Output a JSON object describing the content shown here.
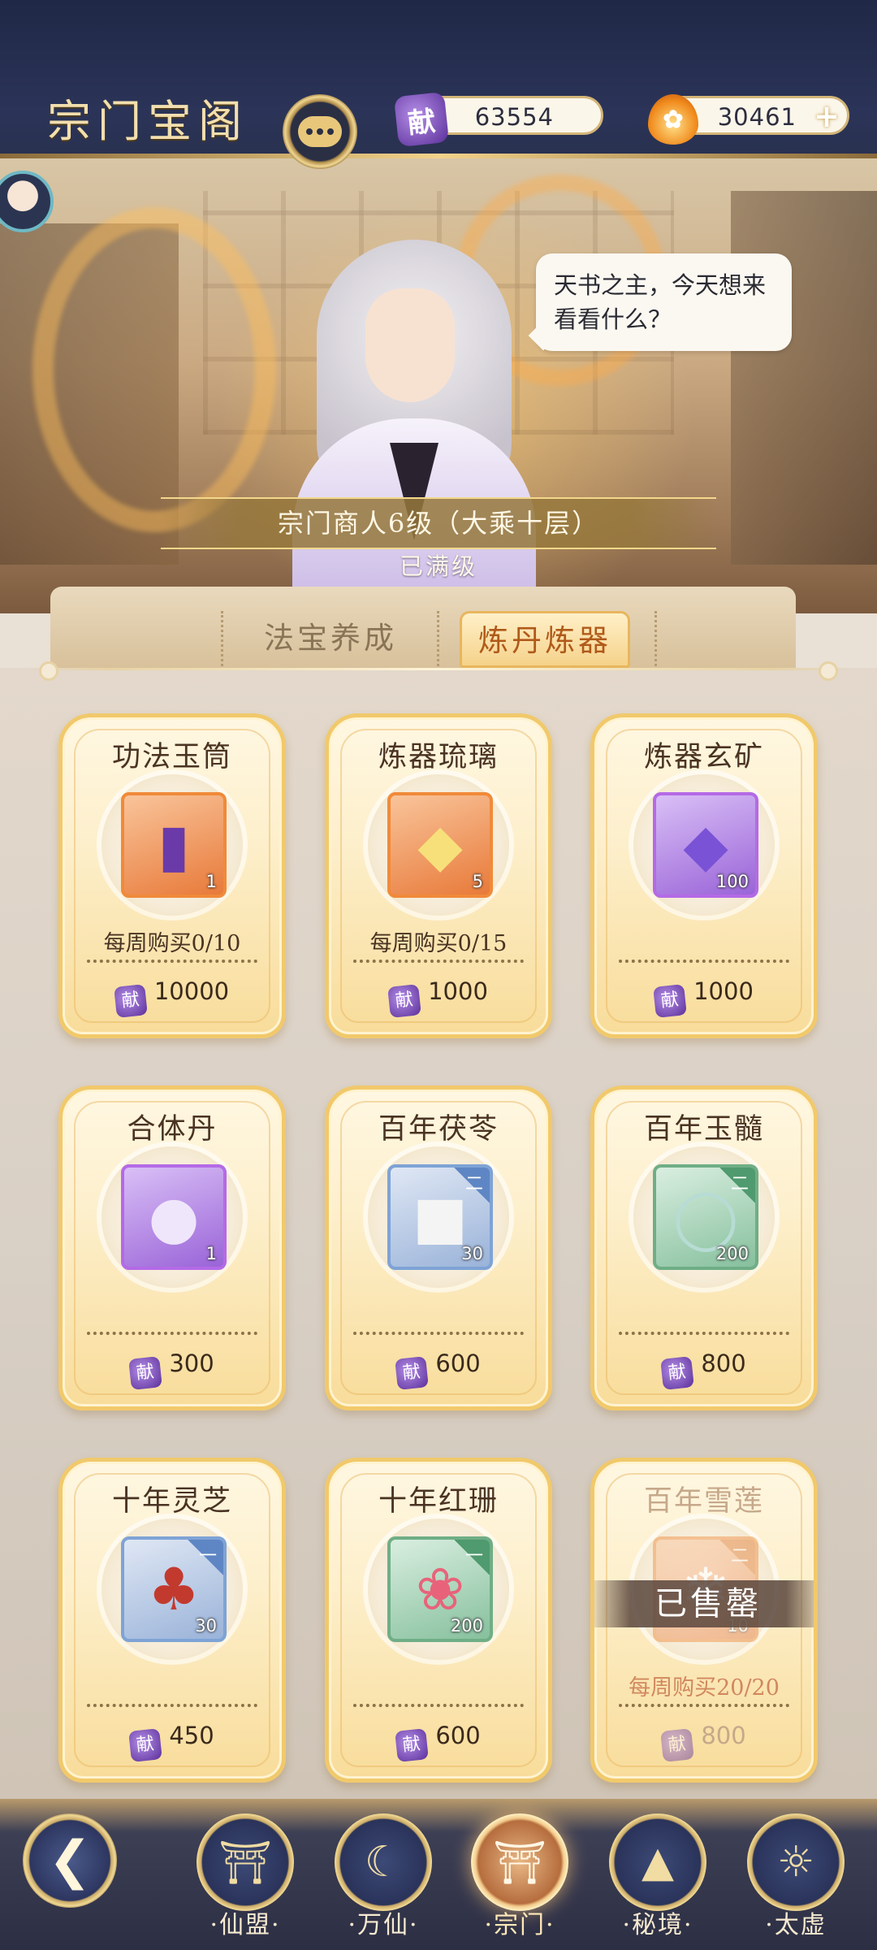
{
  "header": {
    "title": "宗门宝阁",
    "chat_icon": "chat-bubble-icon",
    "currency_contribution": {
      "icon": "contribution-token-icon",
      "icon_text": "献",
      "value": "63554"
    },
    "currency_spirit": {
      "icon": "flame-spirit-icon",
      "value": "30461",
      "plus": "+"
    }
  },
  "hero": {
    "speech": "天书之主，今天想来看看什么？",
    "merchant_level": "宗门商人6级（大乘十层）",
    "max_level": "已满级"
  },
  "tabs": [
    {
      "label": "法宝养成",
      "active": false
    },
    {
      "label": "炼丹炼器",
      "active": true
    }
  ],
  "shop": {
    "currency_icon_text": "献",
    "sold_out_label": "已售罄",
    "items": [
      {
        "name": "功法玉筒",
        "rarity": "orange",
        "tier": "",
        "qty": "1",
        "limit": "每周购买0/10",
        "price": "10000",
        "icon": "jade-scroll-icon"
      },
      {
        "name": "炼器琉璃",
        "rarity": "orange",
        "tier": "",
        "qty": "5",
        "limit": "每周购买0/15",
        "price": "1000",
        "icon": "crystal-cluster-icon"
      },
      {
        "name": "炼器玄矿",
        "rarity": "purple",
        "tier": "",
        "qty": "100",
        "limit": "",
        "price": "1000",
        "icon": "purple-ore-icon"
      },
      {
        "name": "合体丹",
        "rarity": "purple",
        "tier": "",
        "qty": "1",
        "limit": "",
        "price": "300",
        "icon": "pill-gourd-icon"
      },
      {
        "name": "百年茯苓",
        "rarity": "blue",
        "tier": "二",
        "qty": "30",
        "limit": "",
        "price": "600",
        "icon": "poria-herb-icon"
      },
      {
        "name": "百年玉髓",
        "rarity": "green",
        "tier": "二",
        "qty": "200",
        "limit": "",
        "price": "800",
        "icon": "jade-ring-icon"
      },
      {
        "name": "十年灵芝",
        "rarity": "blue",
        "tier": "一",
        "qty": "30",
        "limit": "",
        "price": "450",
        "icon": "lingzhi-mushroom-icon"
      },
      {
        "name": "十年红珊",
        "rarity": "green",
        "tier": "一",
        "qty": "200",
        "limit": "",
        "price": "600",
        "icon": "red-coral-icon"
      },
      {
        "name": "百年雪莲",
        "rarity": "orange",
        "tier": "二",
        "qty": "10",
        "limit": "每周购买20/20",
        "price": "800",
        "icon": "snow-lotus-icon",
        "sold_out": true
      }
    ]
  },
  "bottom_nav": {
    "back_icon": "back-arrow-icon",
    "items": [
      {
        "label": "·仙盟·",
        "icon": "gate-icon",
        "active": false
      },
      {
        "label": "·万仙·",
        "icon": "sword-crescent-icon",
        "active": false
      },
      {
        "label": "·宗门·",
        "icon": "sect-hall-icon",
        "active": true
      },
      {
        "label": "·秘境·",
        "icon": "secret-realm-icon",
        "active": false
      },
      {
        "label": "·太虚",
        "icon": "void-icon",
        "active": false
      }
    ]
  }
}
